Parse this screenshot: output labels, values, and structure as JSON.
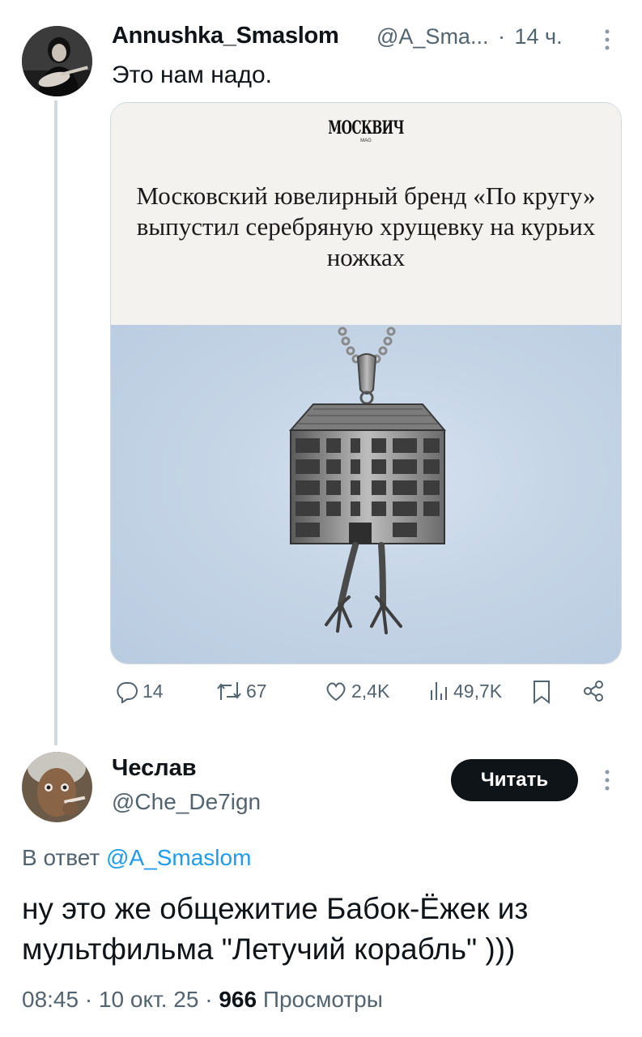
{
  "tweet": {
    "author_name": "Annushka_Smaslom",
    "author_handle": "@A_Sma...",
    "time": "14 ч.",
    "separator": "·",
    "more_icon": "more-vertical-icon",
    "text": "Это нам надо.",
    "card": {
      "logo": "МОСКВИЧ",
      "logo_sub": "MAG",
      "headline": "Московский ювелирный бренд «По кругу» выпустил серебряную хрущевку на курьих ножках",
      "image": "silver-khrushchevka-pendant-on-chicken-legs"
    },
    "actions": {
      "replies": "14",
      "retweets": "67",
      "likes": "2,4K",
      "views": "49,7K"
    }
  },
  "reply": {
    "author_name": "Чеслав",
    "author_handle": "@Che_De7ign",
    "follow_button": "Читать",
    "reply_to_prefix": "В ответ",
    "reply_to_handle": "@A_Smaslom",
    "text": "ну это же общежитие Бабок-Ёжек из мультфильма \"Летучий корабль\" )))",
    "time": "08:45",
    "date": "10 окт. 25",
    "views_count": "966",
    "views_label": "Просмотры"
  },
  "colors": {
    "text_primary": "#0f1419",
    "text_secondary": "#536471",
    "accent": "#1d9bf0",
    "thread_line": "#cfd9de",
    "button_bg": "#0f1419"
  }
}
